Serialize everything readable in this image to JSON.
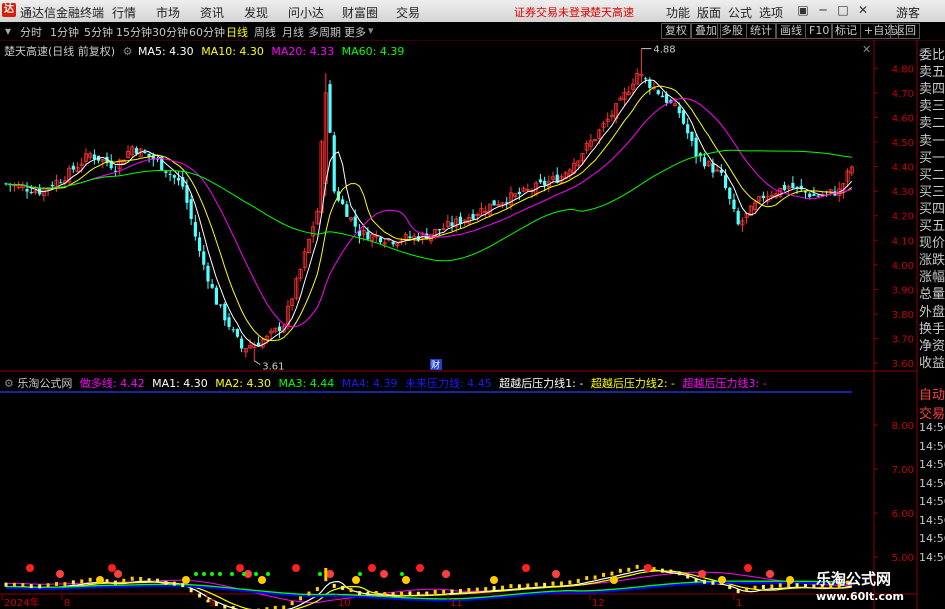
{
  "titlebar": {
    "app_name": "通达信金融终端",
    "menu": [
      "行情",
      "市场",
      "资讯",
      "发现",
      "问小达",
      "财富圈",
      "交易"
    ],
    "alerts": [
      "证券交易未登录",
      "楚天高速"
    ],
    "right_menu": [
      "功能",
      "版面",
      "公式",
      "选项"
    ],
    "guest": "游客"
  },
  "toolbar": {
    "timeframes": [
      "分时",
      "1分钟",
      "5分钟",
      "15分钟",
      "30分钟",
      "60分钟",
      "日线",
      "周线",
      "月线",
      "多周期",
      "更多"
    ],
    "active_timeframe": "日线",
    "right_buttons": [
      "复权",
      "叠加",
      "多股",
      "统计",
      "画线",
      "F10",
      "标记",
      "+自选",
      "返回"
    ]
  },
  "main_chart": {
    "stock_title": "楚天高速(日线 前复权)",
    "ma_legend": [
      {
        "label": "MA5: 4.30",
        "color": "#ffffff"
      },
      {
        "label": "MA10: 4.30",
        "color": "#ffff00"
      },
      {
        "label": "MA20: 4.33",
        "color": "#ff00ff"
      },
      {
        "label": "MA60: 4.39",
        "color": "#00ff00"
      }
    ],
    "price_ticks": [
      "4.80",
      "4.70",
      "4.60",
      "4.50",
      "4.40",
      "4.30",
      "4.20",
      "4.10",
      "4.00",
      "3.90",
      "3.80",
      "3.70",
      "3.60"
    ],
    "high_label": "4.88",
    "low_label": "3.61",
    "cai_marker": "财"
  },
  "sub_chart": {
    "title": "乐淘公式网",
    "legend": [
      {
        "label": "做多线: 4.42",
        "color": "#ff00ff"
      },
      {
        "label": "MA1: 4.30",
        "color": "#ffffff"
      },
      {
        "label": "MA2: 4.30",
        "color": "#ffff00"
      },
      {
        "label": "MA3: 4.44",
        "color": "#00ff00"
      },
      {
        "label": "MA4: 4.39",
        "color": "#0000ff"
      },
      {
        "label": "未来压力线: 4.45",
        "color": "#0000ff"
      },
      {
        "label": "超越后压力线1: -",
        "color": "#ffffff"
      },
      {
        "label": "超越后压力线2: -",
        "color": "#ffff00"
      },
      {
        "label": "超越后压力线3: -",
        "color": "#ff00ff"
      }
    ],
    "price_ticks": [
      "8.00",
      "7.00",
      "6.00",
      "5.00"
    ]
  },
  "date_axis": [
    "2024年",
    "8",
    "9",
    "10",
    "11",
    "12",
    "1"
  ],
  "right_panel": {
    "items": [
      "委比",
      "卖五",
      "卖四",
      "卖三",
      "卖二",
      "卖一",
      "买一",
      "买二",
      "买三",
      "买四",
      "买五",
      "现价",
      "涨跌",
      "涨幅",
      "总量",
      "外盘",
      "换手",
      "净资",
      "收益"
    ],
    "lower_items": [
      "自动",
      "交易",
      "14:56",
      "14:56",
      "14:56",
      "14:56",
      "14:56",
      "14:56",
      "14:56",
      "14:56"
    ]
  },
  "watermark": {
    "name": "乐淘公式网",
    "url": "www.60lt.com"
  }
}
